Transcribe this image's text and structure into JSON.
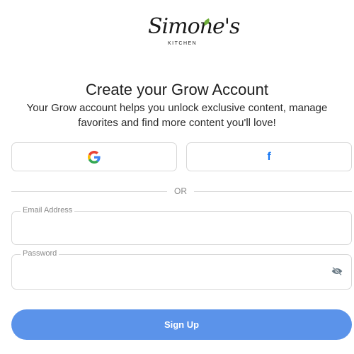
{
  "brand": {
    "logo_script": "Simone's",
    "logo_sub": "KITCHEN"
  },
  "header": {
    "title": "Create your Grow Account",
    "subtitle": "Your Grow account helps you unlock exclusive content, manage favorites and find more content you'll love!"
  },
  "social": {
    "google_icon": "google-g-icon",
    "facebook_icon": "facebook-f-icon",
    "facebook_glyph": "f"
  },
  "divider": {
    "label": "OR"
  },
  "form": {
    "email": {
      "label": "Email Address",
      "value": ""
    },
    "password": {
      "label": "Password",
      "value": "",
      "toggle_icon": "eye-slash-icon"
    }
  },
  "actions": {
    "signup_label": "Sign Up"
  },
  "colors": {
    "primary_button": "#5b93ea",
    "facebook_blue": "#1877f2",
    "google_blue": "#4285f4",
    "google_red": "#ea4335",
    "google_yellow": "#fbbc05",
    "google_green": "#34a853",
    "leaf_green": "#6fae3a"
  }
}
